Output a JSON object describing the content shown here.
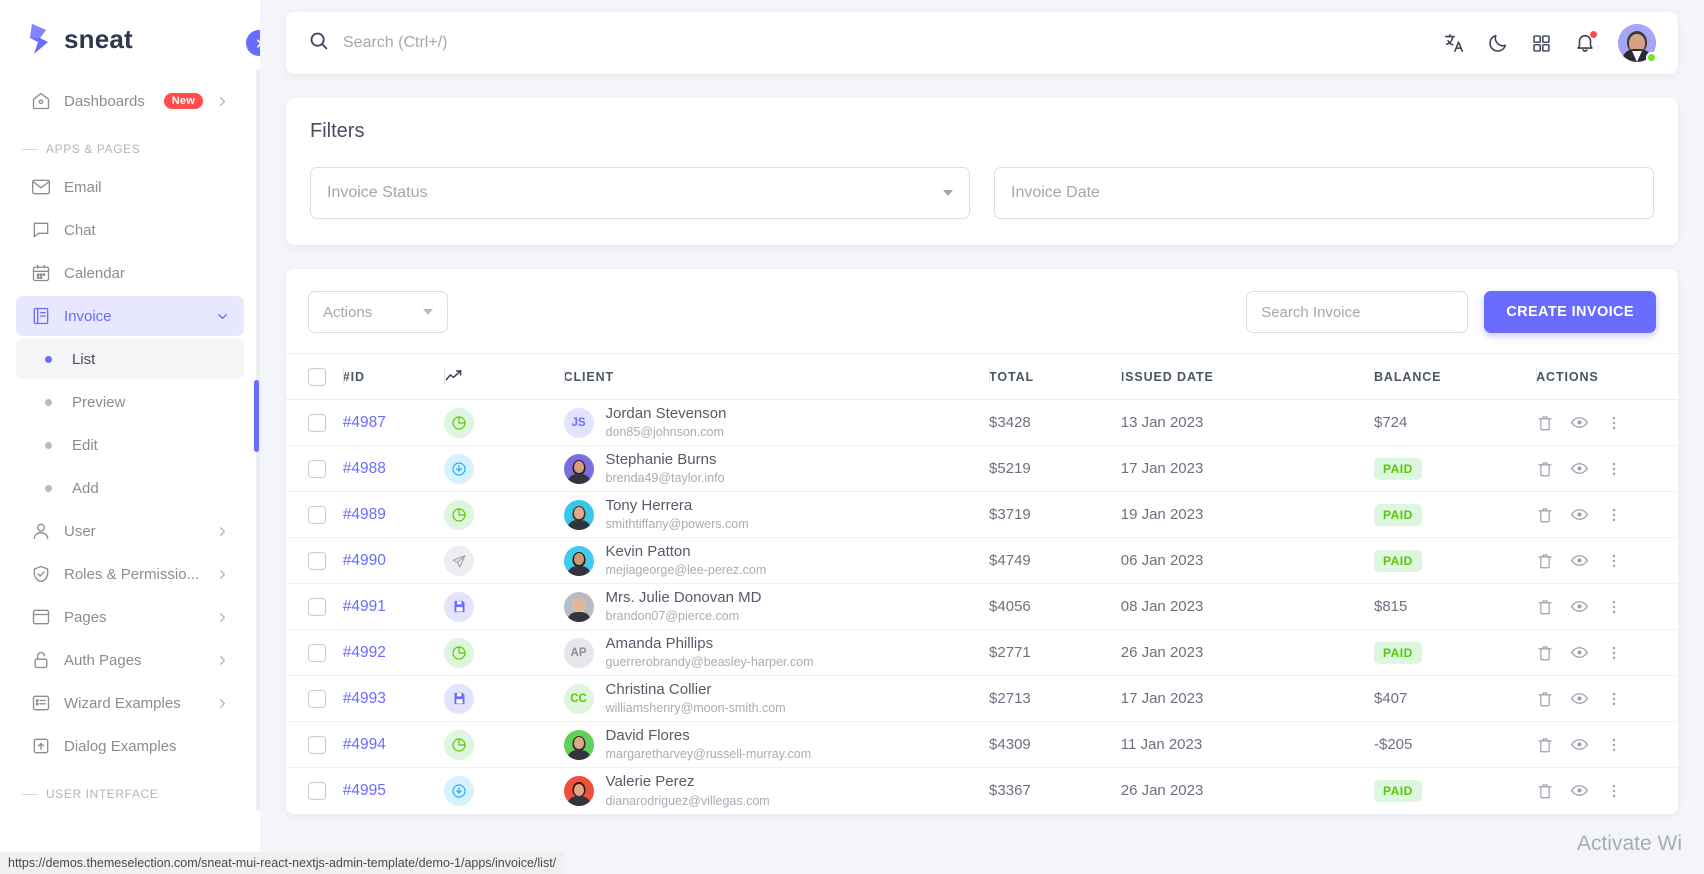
{
  "brand": {
    "name": "sneat"
  },
  "sidebar": {
    "dashboards": {
      "label": "Dashboards",
      "badge": "New",
      "icon": "home-icon"
    },
    "section_apps": "APPS & PAGES",
    "section_ui": "USER INTERFACE",
    "items": [
      {
        "label": "Email",
        "icon": "mail-icon"
      },
      {
        "label": "Chat",
        "icon": "chat-icon"
      },
      {
        "label": "Calendar",
        "icon": "calendar-icon"
      },
      {
        "label": "Invoice",
        "icon": "invoice-icon",
        "active": true,
        "expanded": true
      },
      {
        "label": "List",
        "sub": true,
        "active": true
      },
      {
        "label": "Preview",
        "sub": true
      },
      {
        "label": "Edit",
        "sub": true
      },
      {
        "label": "Add",
        "sub": true
      },
      {
        "label": "User",
        "icon": "user-icon",
        "chevron": true
      },
      {
        "label": "Roles & Permissio...",
        "icon": "shield-icon",
        "chevron": true
      },
      {
        "label": "Pages",
        "icon": "pages-icon",
        "chevron": true
      },
      {
        "label": "Auth Pages",
        "icon": "lock-icon",
        "chevron": true
      },
      {
        "label": "Wizard Examples",
        "icon": "list-icon",
        "chevron": true
      },
      {
        "label": "Dialog Examples",
        "icon": "dialog-icon"
      }
    ]
  },
  "topbar": {
    "search_placeholder": "Search (Ctrl+/)",
    "search_value": "",
    "icons": [
      "translate-icon",
      "moon-icon",
      "apps-grid-icon",
      "bell-icon"
    ],
    "notification_dot": true,
    "avatar_status": "online"
  },
  "filters": {
    "title": "Filters",
    "invoice_status": {
      "label": "Invoice Status",
      "value": ""
    },
    "invoice_date": {
      "label": "Invoice Date",
      "value": ""
    }
  },
  "toolbar": {
    "actions_label": "Actions",
    "search_placeholder": "Search Invoice",
    "search_value": "",
    "create_label": "CREATE INVOICE"
  },
  "table": {
    "columns": [
      "#ID",
      "trend-icon",
      "CLIENT",
      "TOTAL",
      "ISSUED DATE",
      "BALANCE",
      "ACTIONS"
    ],
    "headers": {
      "id": "#ID",
      "client": "CLIENT",
      "total": "TOTAL",
      "issued_date": "ISSUED DATE",
      "balance": "BALANCE",
      "actions": "ACTIONS"
    },
    "row_action_icons": [
      "trash-icon",
      "eye-icon",
      "dots-vertical-icon"
    ],
    "rows": [
      {
        "id": "#4987",
        "status_icon": "pie-chart-icon",
        "status_color": "#56ca00",
        "status_bg": "#ddf6dd",
        "name": "Jordan Stevenson",
        "email": "don85@johnson.com",
        "avatar_type": "initials",
        "initials": "JS",
        "avatar_bg": "#e3e3fd",
        "avatar_fg": "#696cff",
        "total": "$3428",
        "date": "13 Jan 2023",
        "balance": "$724",
        "balance_paid": false
      },
      {
        "id": "#4988",
        "status_icon": "download-circle-icon",
        "status_color": "#16b1ff",
        "status_bg": "#d7f2fe",
        "name": "Stephanie Burns",
        "email": "brenda49@taylor.info",
        "avatar_type": "photo",
        "avatar_bg": "#7b6fe0",
        "hair": "#2c2420",
        "skin": "#d79c78",
        "total": "$5219",
        "date": "17 Jan 2023",
        "balance": "PAID",
        "balance_paid": true
      },
      {
        "id": "#4989",
        "status_icon": "pie-chart-icon",
        "status_color": "#56ca00",
        "status_bg": "#ddf6dd",
        "name": "Tony Herrera",
        "email": "smithtiffany@powers.com",
        "avatar_type": "photo",
        "avatar_bg": "#38c6ea",
        "hair": "#4a3324",
        "skin": "#e0ac8c",
        "total": "$3719",
        "date": "19 Jan 2023",
        "balance": "PAID",
        "balance_paid": true
      },
      {
        "id": "#4990",
        "status_icon": "send-icon",
        "status_color": "#a8aab4",
        "status_bg": "#eceef1",
        "name": "Kevin Patton",
        "email": "mejiageorge@lee-perez.com",
        "avatar_type": "photo",
        "avatar_bg": "#41ccef",
        "hair": "#241c16",
        "skin": "#cf9671",
        "total": "$4749",
        "date": "06 Jan 2023",
        "balance": "PAID",
        "balance_paid": true
      },
      {
        "id": "#4991",
        "status_icon": "save-icon",
        "status_color": "#696cff",
        "status_bg": "#e3e3fd",
        "name": "Mrs. Julie Donovan MD",
        "email": "brandon07@pierce.com",
        "avatar_type": "photo",
        "avatar_bg": "#b9bcc4",
        "hair": "#d8c49a",
        "skin": "#e5b392",
        "total": "$4056",
        "date": "08 Jan 2023",
        "balance": "$815",
        "balance_paid": false
      },
      {
        "id": "#4992",
        "status_icon": "pie-chart-icon",
        "status_color": "#56ca00",
        "status_bg": "#ddf6dd",
        "name": "Amanda Phillips",
        "email": "guerrerobrandy@beasley-harper.com",
        "avatar_type": "initials",
        "initials": "AP",
        "avatar_bg": "#e6e7ea",
        "avatar_fg": "#8b8d98",
        "total": "$2771",
        "date": "26 Jan 2023",
        "balance": "PAID",
        "balance_paid": true
      },
      {
        "id": "#4993",
        "status_icon": "save-icon",
        "status_color": "#696cff",
        "status_bg": "#e3e3fd",
        "name": "Christina Collier",
        "email": "williamshenry@moon-smith.com",
        "avatar_type": "initials",
        "initials": "CC",
        "avatar_bg": "#ddf6dd",
        "avatar_fg": "#56ca00",
        "total": "$2713",
        "date": "17 Jan 2023",
        "balance": "$407",
        "balance_paid": false
      },
      {
        "id": "#4994",
        "status_icon": "pie-chart-icon",
        "status_color": "#56ca00",
        "status_bg": "#ddf6dd",
        "name": "David Flores",
        "email": "margaretharvey@russell-murray.com",
        "avatar_type": "photo",
        "avatar_bg": "#62cf5a",
        "hair": "#3b2c21",
        "skin": "#dba98a",
        "total": "$4309",
        "date": "11 Jan 2023",
        "balance": "-$205",
        "balance_paid": false
      },
      {
        "id": "#4995",
        "status_icon": "download-circle-icon",
        "status_color": "#16b1ff",
        "status_bg": "#d7f2fe",
        "name": "Valerie Perez",
        "email": "dianarodriguez@villegas.com",
        "avatar_type": "photo",
        "avatar_bg": "#f0503c",
        "hair": "#2e1d14",
        "skin": "#e0a584",
        "total": "$3367",
        "date": "26 Jan 2023",
        "balance": "PAID",
        "balance_paid": true
      }
    ]
  },
  "statusbar": {
    "url": "https://demos.themeselection.com/sneat-mui-react-nextjs-admin-template/demo-1/apps/invoice/list/"
  },
  "watermark": {
    "line1": "Activate Wi"
  },
  "colors": {
    "primary": "#696cff",
    "success": "#56ca00",
    "info": "#16b1ff",
    "danger": "#ff4d49",
    "page_bg": "#f4f5fa"
  }
}
